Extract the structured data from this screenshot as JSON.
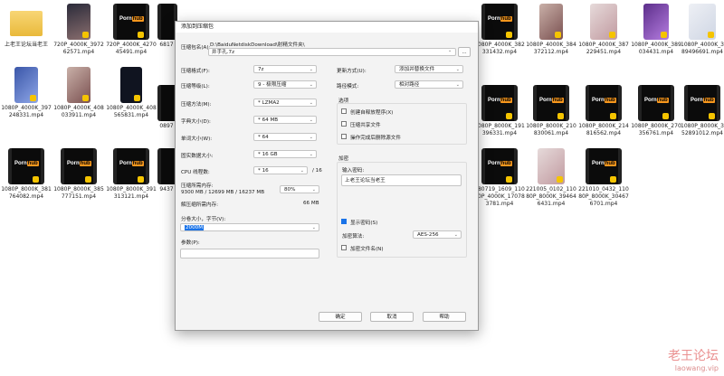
{
  "desktop": {
    "row1": [
      "上老王论坛当老王",
      "720P_4000K_397262571.mp4",
      "720P_4000K_427045491.mp4",
      "",
      "",
      "",
      "",
      "",
      "1080P_4000K_382331432.mp4",
      "1080P_4000K_384372112.mp4",
      "1080P_4000K_387229451.mp4",
      "1080P_4000K_389034431.mp4",
      "1080P_4000K_389496691.mp4"
    ],
    "row2": [
      "1080P_4000K_397248331.mp4",
      "1080P_4000K_408033911.mp4",
      "1080P_4000K_408565831.mp4",
      "",
      "1080P_8000K_191396331.mp4",
      "1080P_8000K_210830061.mp4",
      "1080P_8000K_214816562.mp4",
      "1080P_8000K_270356761.mp4",
      "1080P_8000K_352891012.mp4"
    ],
    "row3": [
      "1080P_8000K_381764082.mp4",
      "1080P_8000K_385777151.mp4",
      "1080P_8000K_391313121.mp4",
      "180719_1609_11080P_4000K_170783781.mp4",
      "221005_0102_11080P_8000K_394646431.mp4",
      "221010_0432_11080P_8000K_304676701.mp4"
    ],
    "partial": [
      "1080",
      "6817",
      "0897",
      "9437",
      "1080"
    ]
  },
  "dialog": {
    "title": "添加到压缩包",
    "archive_label": "压缩包名(A):",
    "archive_path": "D:\\BaiduNetdiskDownload\\射精文件夹\\",
    "archive_name": "井手孔.7z",
    "browse": "...",
    "format_label": "压缩格式(F):",
    "format_val": "7z",
    "level_label": "压缩等级(L):",
    "level_val": "9 - 极限压缩",
    "method_label": "压缩方法(M):",
    "method_val": "* LZMA2",
    "dict_label": "字典大小(D):",
    "dict_val": "* 64 MB",
    "word_label": "单词大小(W):",
    "word_val": "* 64",
    "solid_label": "固实数据大小:",
    "solid_val": "* 16 GB",
    "cpu_label": "CPU 线程数:",
    "cpu_val": "* 16",
    "cpu_total": "/ 16",
    "mem_label": "压缩所需内存:",
    "mem_detail": "9300 MB / 12699 MB / 16237 MB",
    "mem_pct": "80%",
    "demem_label": "解压缩所需内存:",
    "demem_val": "66 MB",
    "split_label": "分卷大小，字节(V):",
    "split_val": "2000M",
    "params_label": "参数(P):",
    "update_label": "更新方式(U):",
    "update_val": "添加并替换文件",
    "path_label": "路径模式:",
    "path_val": "相对路径",
    "options_title": "选项",
    "opt1": "创建自释放程序(X)",
    "opt2": "压缩共享文件",
    "opt3": "操作完成后删除源文件",
    "enc_title": "加密",
    "pwd_label": "输入密码:",
    "pwd_val": "上老王论坛当老王",
    "show_pwd": "显示密码(S)",
    "enc_method_label": "加密算法:",
    "enc_method_val": "AES-256",
    "enc_names": "加密文件名(N)",
    "ok": "确定",
    "cancel": "取消",
    "help": "帮助"
  },
  "watermark": {
    "title": "老王论坛",
    "url": "laowang.vip"
  }
}
